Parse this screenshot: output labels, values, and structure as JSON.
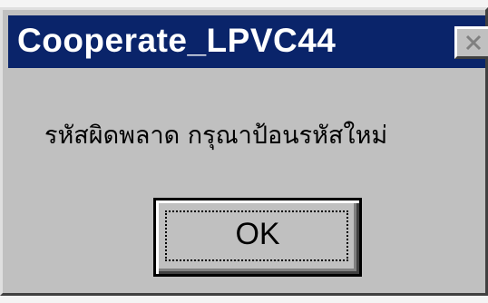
{
  "dialog": {
    "title": "Cooperate_LPVC44",
    "message": "รหัสผิดพลาด กรุณาป้อนรหัสใหม่",
    "ok_label": "OK",
    "close_icon": "close-icon"
  },
  "colors": {
    "title_bar": "#0a246a",
    "title_text": "#ffffff",
    "dialog_face": "#c0c0c0",
    "text": "#000000"
  }
}
